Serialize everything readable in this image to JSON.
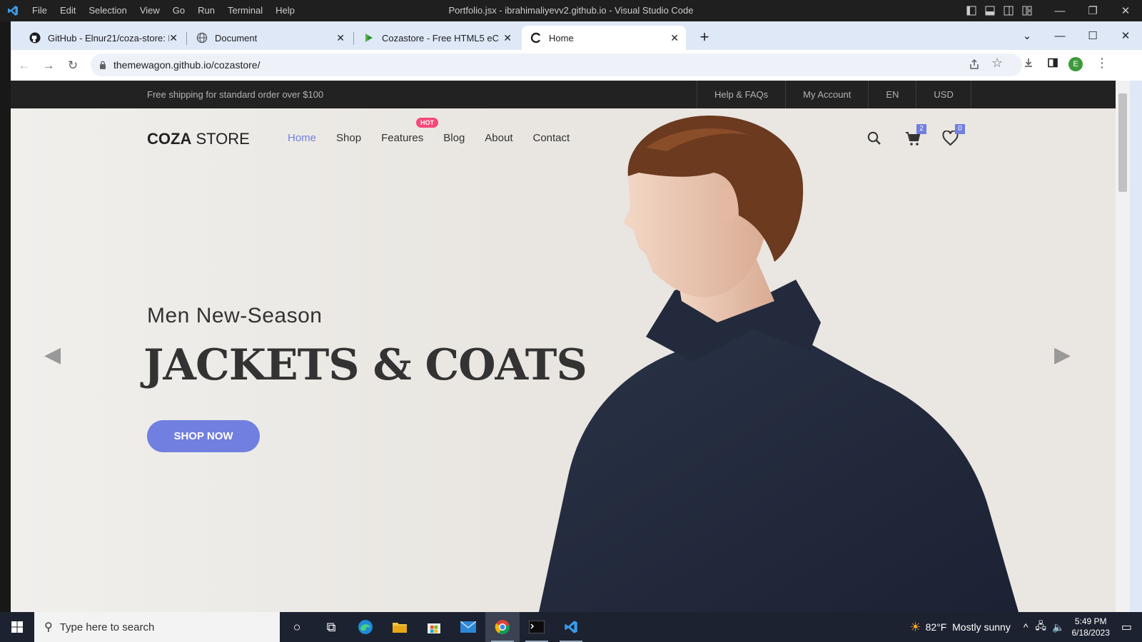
{
  "vscode": {
    "menu": [
      "File",
      "Edit",
      "Selection",
      "View",
      "Go",
      "Run",
      "Terminal",
      "Help"
    ],
    "title": "Portfolio.jsx - ibrahimaliyevv2.github.io - Visual Studio Code"
  },
  "browser": {
    "tabs": [
      {
        "title": "GitHub - Elnur21/coza-store: M",
        "icon": "github-icon"
      },
      {
        "title": "Document",
        "icon": "globe-icon"
      },
      {
        "title": "Cozastore - Free HTML5 eComr",
        "icon": "cozastore-icon"
      },
      {
        "title": "Home",
        "icon": "loading-icon"
      }
    ],
    "url": "themewagon.github.io/cozastore/",
    "profile_initial": "E"
  },
  "site": {
    "shipping_notice": "Free shipping for standard order over $100",
    "top_links": [
      "Help & FAQs",
      "My Account",
      "EN",
      "USD"
    ],
    "logo_bold": "COZA",
    "logo_rest": " STORE",
    "nav": [
      "Home",
      "Shop",
      "Features",
      "Blog",
      "About",
      "Contact"
    ],
    "hot_badge": "HOT",
    "cart_count": "2",
    "wishlist_count": "0",
    "hero": {
      "eyebrow": "Men New-Season",
      "headline": "JACKETS & COATS",
      "cta": "SHOP NOW"
    }
  },
  "taskbar": {
    "search_placeholder": "Type here to search",
    "weather": "82°F  Mostly sunny",
    "time": "5:49 PM",
    "date": "6/18/2023"
  },
  "colors": {
    "accent": "#717fe0",
    "hot": "#f74877",
    "topbar": "#222222"
  }
}
